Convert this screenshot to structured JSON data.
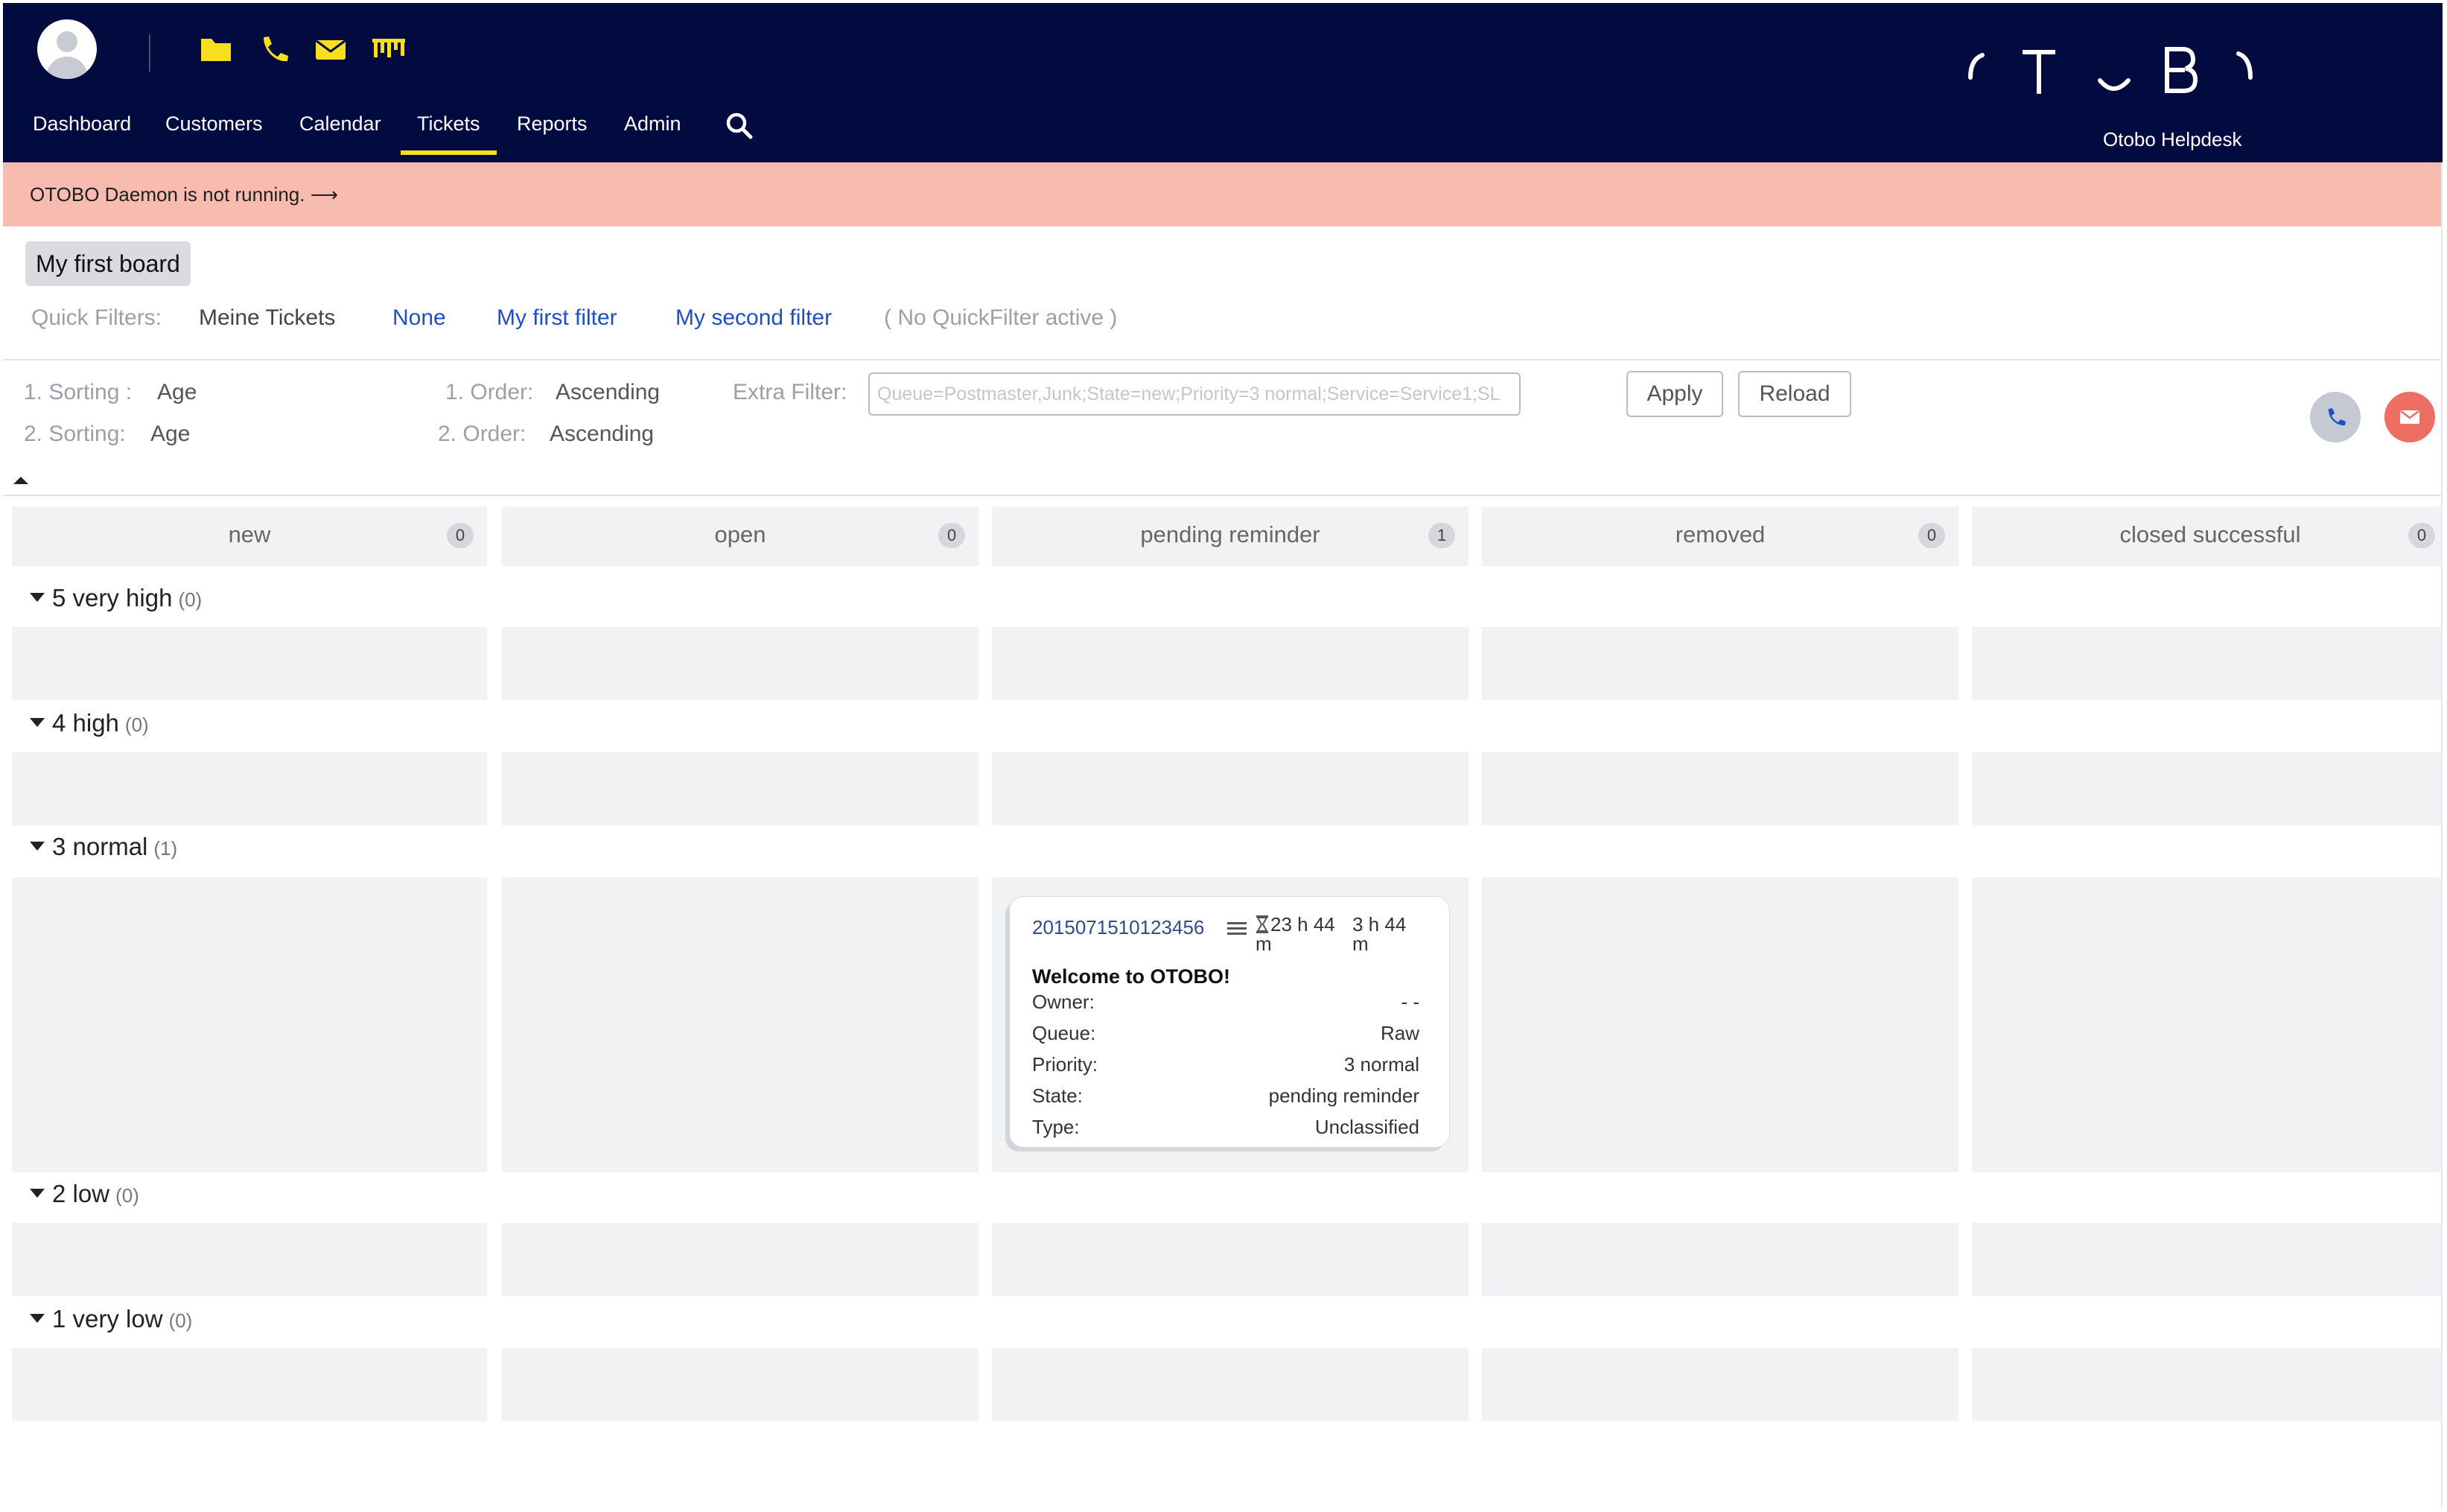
{
  "header": {
    "brand": "Otobo Helpdesk",
    "quick_icons": [
      "folder-icon",
      "phone-icon",
      "envelope-icon",
      "board-icon"
    ],
    "nav": [
      "Dashboard",
      "Customers",
      "Calendar",
      "Tickets",
      "Reports",
      "Admin"
    ],
    "active_nav": "Tickets",
    "accent": "#f7df1e",
    "background": "#010b3f"
  },
  "banner": {
    "text": "OTOBO Daemon is not running. ⟶",
    "color": "#f8bbb0"
  },
  "board": {
    "title": "My first board"
  },
  "quick_filters": {
    "label": "Quick Filters:",
    "current": "Meine Tickets",
    "items": [
      "None",
      "My first filter",
      "My second filter"
    ],
    "status": "( No QuickFilter active )"
  },
  "sorting": {
    "sort1_label": "1. Sorting :",
    "sort1_value": "Age",
    "sort2_label": "2. Sorting:",
    "sort2_value": "Age",
    "order1_label": "1. Order:",
    "order1_value": "Ascending",
    "order2_label": "2. Order:",
    "order2_value": "Ascending",
    "extra_label": "Extra Filter:",
    "extra_placeholder": "Queue=Postmaster,Junk;State=new;Priority=3 normal;Service=Service1;SL",
    "apply": "Apply",
    "reload": "Reload"
  },
  "columns": [
    {
      "name": "new",
      "count": "0"
    },
    {
      "name": "open",
      "count": "0"
    },
    {
      "name": "pending reminder",
      "count": "1"
    },
    {
      "name": "removed",
      "count": "0"
    },
    {
      "name": "closed successful",
      "count": "0"
    }
  ],
  "priorities": [
    {
      "name": "5 very high",
      "count": "(0)"
    },
    {
      "name": "4 high",
      "count": "(0)"
    },
    {
      "name": "3 normal",
      "count": "(1)"
    },
    {
      "name": "2 low",
      "count": "(0)"
    },
    {
      "name": "1 very low",
      "count": "(0)"
    }
  ],
  "ticket": {
    "number": "2015071510123456",
    "time1": "23 h 44",
    "time1_unit": "m",
    "time2": "3 h 44",
    "time2_unit": "m",
    "title": "Welcome to OTOBO!",
    "fields": [
      {
        "key": "Owner:",
        "value": "- -"
      },
      {
        "key": "Queue:",
        "value": "Raw"
      },
      {
        "key": "Priority:",
        "value": "3 normal"
      },
      {
        "key": "State:",
        "value": "pending reminder"
      },
      {
        "key": "Type:",
        "value": "Unclassified"
      }
    ]
  }
}
